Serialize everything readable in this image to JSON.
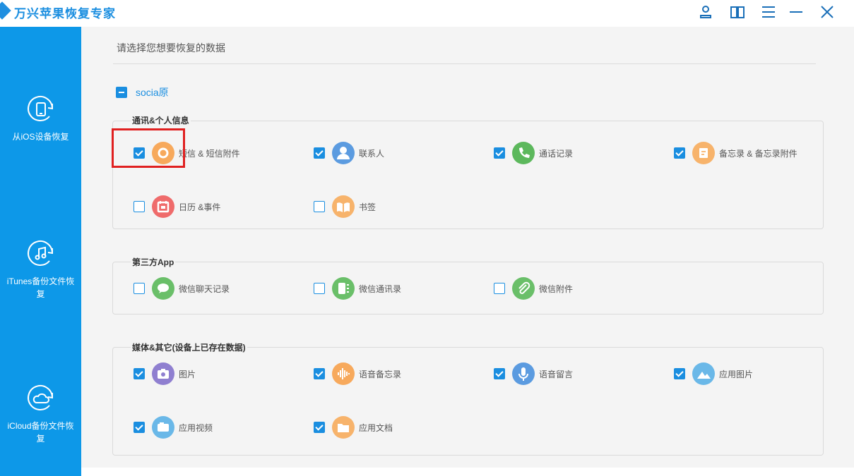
{
  "app": {
    "title": "万兴苹果恢复专家"
  },
  "sidebar": {
    "items": [
      {
        "label": "从iOS设备恢复",
        "icon": "phone-recover-icon"
      },
      {
        "label": "iTunes备份文件恢\n复",
        "icon": "music-recover-icon"
      },
      {
        "label": "iCloud备份文件恢\n复",
        "icon": "cloud-recover-icon"
      }
    ]
  },
  "main": {
    "instruction": "请选择您想要恢复的数据",
    "master_label": "socia原",
    "groups": [
      {
        "title": "通讯&个人信息",
        "items": [
          {
            "label": "短信 & 短信附件",
            "checked": true,
            "icon": "message-icon",
            "color": "#f7a95c"
          },
          {
            "label": "联系人",
            "checked": true,
            "icon": "contact-icon",
            "color": "#5b9be0"
          },
          {
            "label": "通话记录",
            "checked": true,
            "icon": "phone-icon",
            "color": "#5cb85c"
          },
          {
            "label": "备忘录 & 备忘录附件",
            "checked": true,
            "icon": "note-icon",
            "color": "#f7b36b"
          },
          {
            "label": "日历 &事件",
            "checked": false,
            "icon": "calendar-icon",
            "color": "#ef6b6b"
          },
          {
            "label": "书签",
            "checked": false,
            "icon": "bookmark-icon",
            "color": "#f7b36b"
          }
        ]
      },
      {
        "title": "第三方App",
        "items": [
          {
            "label": "微信聊天记录",
            "checked": false,
            "icon": "chat-bubble-icon",
            "color": "#6abf69"
          },
          {
            "label": "微信通讯录",
            "checked": false,
            "icon": "contact-card-icon",
            "color": "#6abf69"
          },
          {
            "label": "微信附件",
            "checked": false,
            "icon": "paperclip-icon",
            "color": "#6abf69"
          }
        ]
      },
      {
        "title": "媒体&其它(设备上已存在数据)",
        "items": [
          {
            "label": "图片",
            "checked": true,
            "icon": "camera-icon",
            "color": "#8f7fd0"
          },
          {
            "label": "语音备忘录",
            "checked": true,
            "icon": "waveform-icon",
            "color": "#f7a95c"
          },
          {
            "label": "语音留言",
            "checked": true,
            "icon": "microphone-icon",
            "color": "#5b9be0"
          },
          {
            "label": "应用图片",
            "checked": true,
            "icon": "mountain-image-icon",
            "color": "#6ab8e8"
          },
          {
            "label": "应用视频",
            "checked": true,
            "icon": "video-camera-icon",
            "color": "#6ab8e8"
          },
          {
            "label": "应用文档",
            "checked": true,
            "icon": "folder-icon",
            "color": "#f7b36b"
          }
        ]
      }
    ]
  },
  "colors": {
    "accent": "#1a8ee0",
    "sidebar": "#0d98e8",
    "highlight": "#e02020"
  }
}
